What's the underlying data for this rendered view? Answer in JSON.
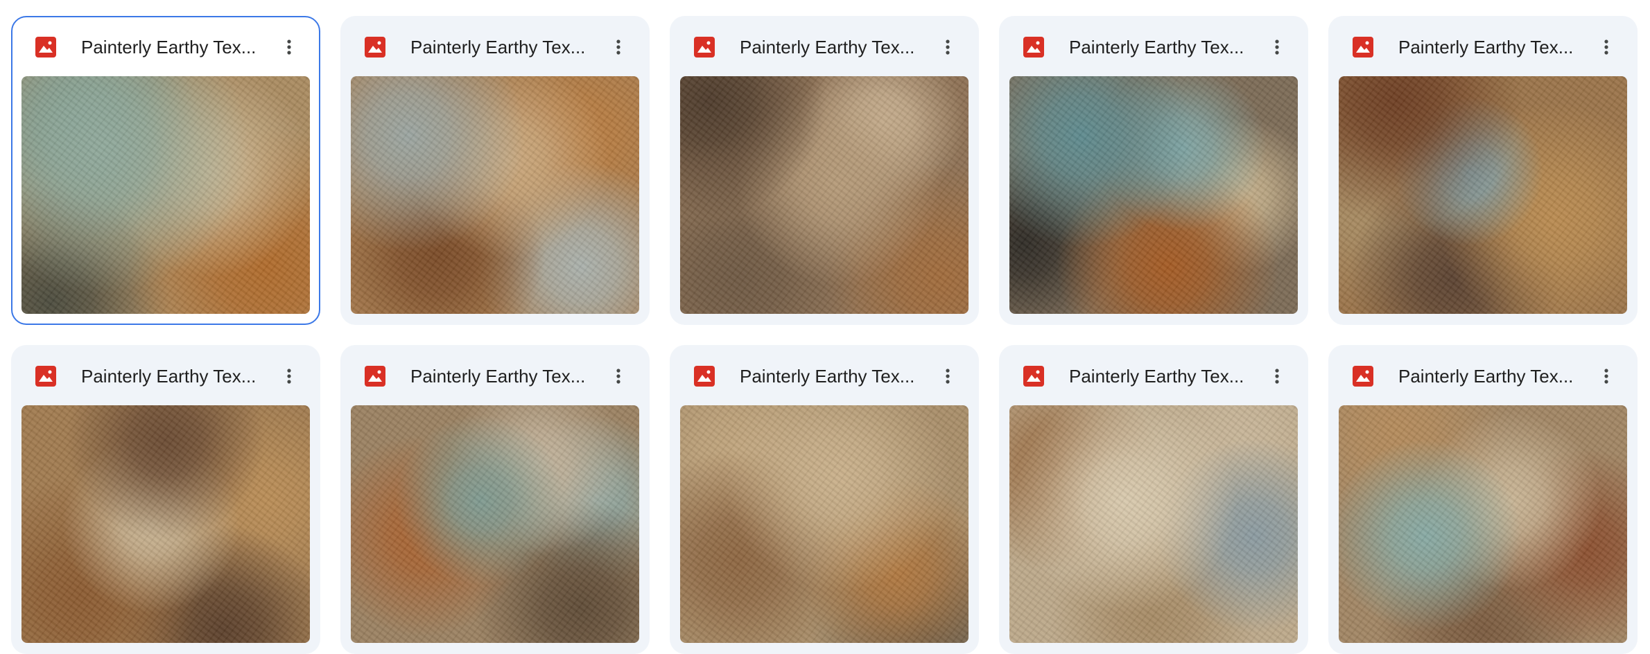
{
  "files": [
    {
      "title": "Painterly Earthy Tex...",
      "selected": true,
      "base": "#a98a5f",
      "blobs": [
        [
          "#8fa89a",
          28,
          30,
          55
        ],
        [
          "#c9b48f",
          65,
          40,
          45
        ],
        [
          "#b06a2a",
          85,
          80,
          45
        ],
        [
          "#4a4a3c",
          10,
          95,
          35
        ],
        [
          "#6f9085",
          20,
          20,
          40
        ]
      ]
    },
    {
      "title": "Painterly Earthy Tex...",
      "selected": false,
      "base": "#a67a4c",
      "blobs": [
        [
          "#9aa4a0",
          20,
          25,
          40
        ],
        [
          "#c9a77c",
          55,
          35,
          45
        ],
        [
          "#7a4a26",
          30,
          75,
          40
        ],
        [
          "#a9b0ab",
          80,
          80,
          35
        ],
        [
          "#b87b3f",
          80,
          25,
          35
        ]
      ]
    },
    {
      "title": "Painterly Earthy Tex...",
      "selected": false,
      "base": "#8d7053",
      "blobs": [
        [
          "#4d3a2a",
          10,
          10,
          35
        ],
        [
          "#b59a78",
          55,
          45,
          50
        ],
        [
          "#6e5842",
          20,
          85,
          40
        ],
        [
          "#a06a3a",
          90,
          85,
          35
        ],
        [
          "#c8b090",
          70,
          20,
          30
        ]
      ]
    },
    {
      "title": "Painterly Earthy Tex...",
      "selected": false,
      "base": "#7b6a55",
      "blobs": [
        [
          "#5d8a8e",
          25,
          25,
          40
        ],
        [
          "#7fa4a3",
          60,
          30,
          35
        ],
        [
          "#a45a22",
          55,
          80,
          45
        ],
        [
          "#2e2a24",
          5,
          70,
          30
        ],
        [
          "#c5b08a",
          80,
          50,
          30
        ]
      ]
    },
    {
      "title": "Painterly Earthy Tex...",
      "selected": false,
      "base": "#9a7348",
      "blobs": [
        [
          "#6e3e22",
          20,
          10,
          40
        ],
        [
          "#7e9ca3",
          45,
          40,
          35
        ],
        [
          "#b98a4f",
          75,
          60,
          45
        ],
        [
          "#5a4130",
          40,
          85,
          40
        ],
        [
          "#a78b62",
          10,
          55,
          35
        ]
      ]
    },
    {
      "title": "Painterly Earthy Tex...",
      "selected": false,
      "base": "#a07a4e",
      "blobs": [
        [
          "#6a4a32",
          50,
          15,
          40
        ],
        [
          "#c8b493",
          45,
          50,
          45
        ],
        [
          "#8b5a30",
          20,
          80,
          40
        ],
        [
          "#5b3f2a",
          70,
          95,
          35
        ],
        [
          "#b98c55",
          85,
          40,
          35
        ]
      ]
    },
    {
      "title": "Painterly Earthy Tex...",
      "selected": false,
      "base": "#9a8060",
      "blobs": [
        [
          "#7e9a90",
          45,
          40,
          40
        ],
        [
          "#a8612f",
          25,
          55,
          40
        ],
        [
          "#c2b29a",
          65,
          25,
          35
        ],
        [
          "#5e4a35",
          80,
          85,
          35
        ],
        [
          "#8ca5a0",
          85,
          40,
          30
        ]
      ]
    },
    {
      "title": "Painterly Earthy Tex...",
      "selected": false,
      "base": "#a88d68",
      "blobs": [
        [
          "#c9b08a",
          55,
          30,
          50
        ],
        [
          "#8d6540",
          20,
          65,
          40
        ],
        [
          "#b0773e",
          75,
          70,
          35
        ],
        [
          "#6b5a45",
          85,
          95,
          35
        ],
        [
          "#c0a47c",
          20,
          20,
          35
        ]
      ]
    },
    {
      "title": "Painterly Earthy Tex...",
      "selected": false,
      "base": "#bca889",
      "blobs": [
        [
          "#d8c9ad",
          40,
          40,
          50
        ],
        [
          "#8a9aa0",
          85,
          55,
          35
        ],
        [
          "#9c7148",
          15,
          25,
          35
        ],
        [
          "#a68a64",
          50,
          90,
          40
        ],
        [
          "#c7b598",
          80,
          15,
          30
        ]
      ]
    },
    {
      "title": "Painterly Earthy Tex...",
      "selected": false,
      "base": "#a08462",
      "blobs": [
        [
          "#86a9a3",
          30,
          55,
          40
        ],
        [
          "#c8b494",
          60,
          40,
          40
        ],
        [
          "#8b4e2e",
          85,
          60,
          35
        ],
        [
          "#7a5a3e",
          50,
          95,
          40
        ],
        [
          "#b48a5a",
          20,
          10,
          35
        ]
      ]
    }
  ]
}
